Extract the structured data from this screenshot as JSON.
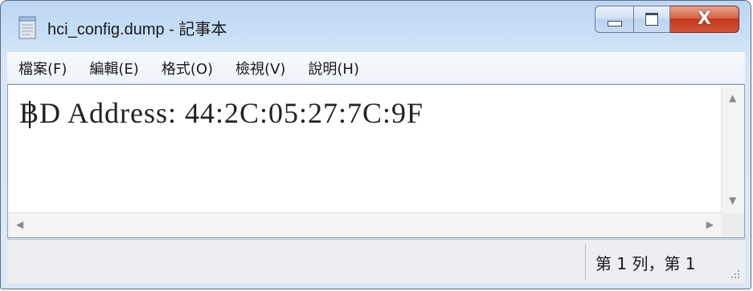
{
  "window": {
    "title": "hci_config.dump - 記事本",
    "icon": "notepad-icon"
  },
  "caption_buttons": {
    "minimize_icon": "minimize-icon",
    "maximize_icon": "maximize-icon",
    "close_icon": "close-icon",
    "close_glyph": "X"
  },
  "menu": {
    "items": [
      {
        "label": "檔案(F)"
      },
      {
        "label": "編輯(E)"
      },
      {
        "label": "格式(O)"
      },
      {
        "label": "檢視(V)"
      },
      {
        "label": "說明(H)"
      }
    ]
  },
  "editor": {
    "content": "BD Address: 44:2C:05:27:7C:9F"
  },
  "statusbar": {
    "position": "第 1 列，第 1"
  },
  "colors": {
    "close_button": "#c3361c",
    "frame": "#c7def7"
  }
}
